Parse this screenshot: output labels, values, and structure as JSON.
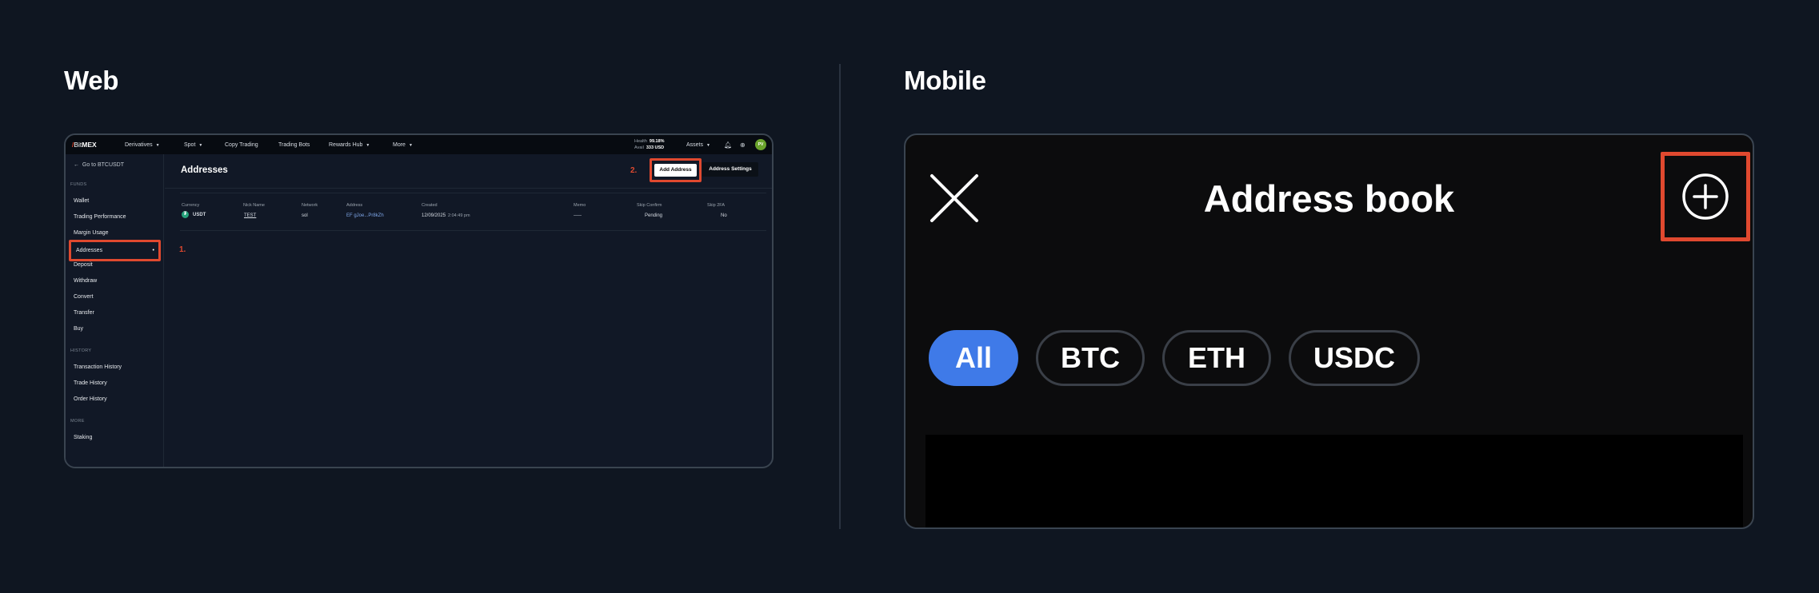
{
  "labels": {
    "web": "Web",
    "mobile": "Mobile"
  },
  "web": {
    "logo": {
      "mark": "/",
      "brand_light": "Bit",
      "brand_bold": "MEX"
    },
    "nav": [
      "Derivatives",
      "Spot",
      "Copy Trading",
      "Trading Bots",
      "Rewards Hub",
      "More"
    ],
    "health": {
      "health_label": "Health",
      "health_value": "99.18%",
      "avail_label": "Avail",
      "avail_value": "333 USD"
    },
    "assets_label": "Assets",
    "avatar_initials": "PV",
    "sidebar": {
      "goto": "Go to BTCUSDT",
      "funds_head": "FUNDS",
      "funds": [
        "Wallet",
        "Trading Performance",
        "Margin Usage",
        "Addresses",
        "Deposit",
        "Withdraw",
        "Convert",
        "Transfer",
        "Buy"
      ],
      "history_head": "HISTORY",
      "history": [
        "Transaction History",
        "Trade History",
        "Order History"
      ],
      "more_head": "MORE",
      "more": [
        "Staking"
      ]
    },
    "annotations": {
      "step1": "1.",
      "step2": "2."
    },
    "main": {
      "title": "Addresses",
      "add_button": "Add Address",
      "settings_button": "Address Settings",
      "columns": [
        "Currency",
        "Nick Name",
        "Network",
        "Address",
        "Created",
        "Memo",
        "Skip Confirm",
        "Skip 2FA"
      ],
      "row": {
        "currency": "USDT",
        "nick": "TEST",
        "network": "sol",
        "address": "EF gJoe...Pr8kZh",
        "created_date": "12/09/2025",
        "created_time": "2:04:49 pm",
        "memo": "-----",
        "skip_confirm": "Pending",
        "skip_2fa": "No"
      }
    }
  },
  "mobile": {
    "title": "Address book",
    "chips": [
      "All",
      "BTC",
      "ETH",
      "USDC"
    ],
    "active_chip": "All"
  },
  "colors": {
    "accent_red": "#e0492f",
    "chip_active": "#3f7ae8",
    "background": "#0f1621"
  }
}
